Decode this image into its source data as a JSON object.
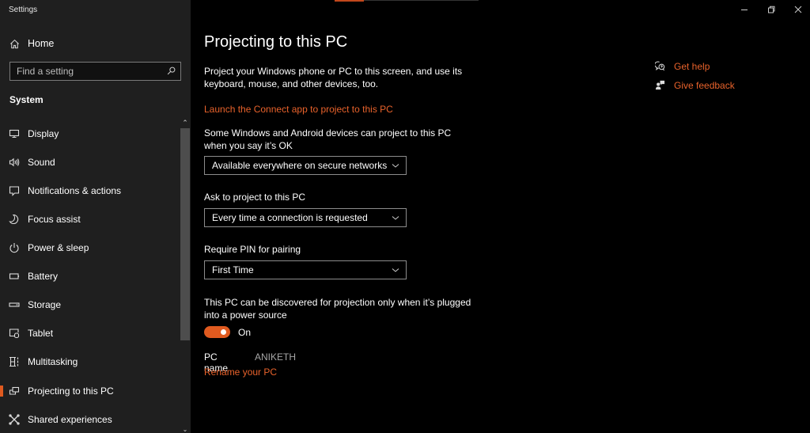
{
  "window": {
    "app_title": "Settings",
    "controls": [
      "minimize",
      "restore",
      "close"
    ],
    "accent_color": "#e05a1f"
  },
  "sidebar": {
    "home_label": "Home",
    "search_placeholder": "Find a setting",
    "section_title": "System",
    "items": [
      {
        "label": "Display",
        "icon": "display-icon"
      },
      {
        "label": "Sound",
        "icon": "sound-icon"
      },
      {
        "label": "Notifications & actions",
        "icon": "notifications-icon"
      },
      {
        "label": "Focus assist",
        "icon": "moon-icon"
      },
      {
        "label": "Power & sleep",
        "icon": "power-icon"
      },
      {
        "label": "Battery",
        "icon": "battery-icon"
      },
      {
        "label": "Storage",
        "icon": "storage-icon"
      },
      {
        "label": "Tablet",
        "icon": "tablet-icon"
      },
      {
        "label": "Multitasking",
        "icon": "multitasking-icon"
      },
      {
        "label": "Projecting to this PC",
        "icon": "projecting-icon",
        "selected": true
      },
      {
        "label": "Shared experiences",
        "icon": "shared-experiences-icon"
      }
    ]
  },
  "main": {
    "title": "Projecting to this PC",
    "description": "Project your Windows phone or PC to this screen, and use its keyboard, mouse, and other devices, too.",
    "launch_link": "Launch the Connect app to project to this PC",
    "availability": {
      "label": "Some Windows and Android devices can project to this PC when you say it’s OK",
      "value": "Available everywhere on secure networks"
    },
    "ask": {
      "label": "Ask to project to this PC",
      "value": "Every time a connection is requested"
    },
    "pin": {
      "label": "Require PIN for pairing",
      "value": "First Time"
    },
    "power": {
      "label": "This PC can be discovered for projection only when it’s plugged into a power source",
      "toggle_state": "On",
      "toggle_on": true
    },
    "pc_name": {
      "label": "PC name",
      "value": "ANIKETH",
      "rename_link": "Rename your PC"
    }
  },
  "help_panel": {
    "get_help": "Get help",
    "give_feedback": "Give feedback"
  }
}
